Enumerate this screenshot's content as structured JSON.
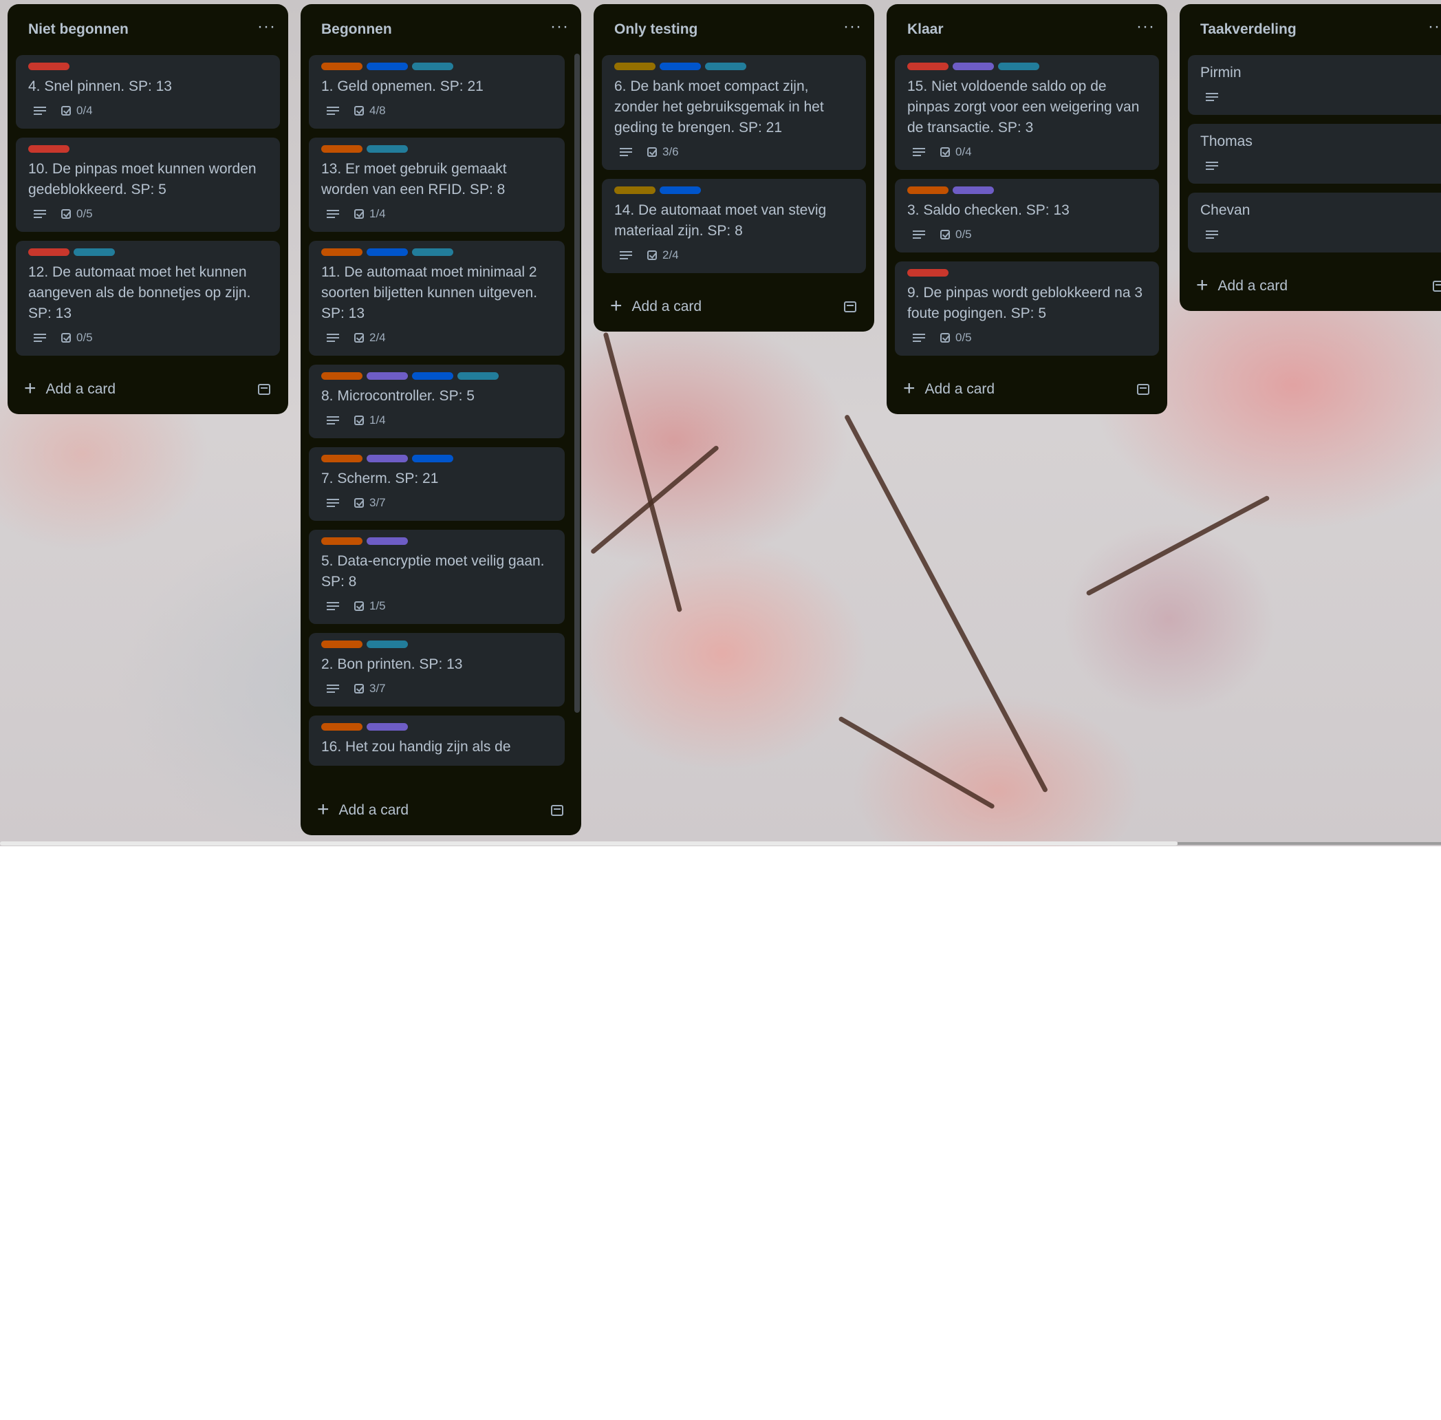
{
  "colors": {
    "red": "#c9372c",
    "orange": "#c25100",
    "blue": "#0055cc",
    "teal": "#227d9b",
    "purple": "#6e5dc6",
    "olive": "#946f00"
  },
  "add_card_label": "Add a card",
  "menu_glyph": "···",
  "lists": [
    {
      "title": "Niet begonnen",
      "cards": [
        {
          "labels": [
            "red"
          ],
          "title": "4. Snel pinnen. SP: 13",
          "checklist": "0/4"
        },
        {
          "labels": [
            "red"
          ],
          "title": "10. De pinpas moet kunnen worden gedeblokkeerd. SP: 5",
          "checklist": "0/5"
        },
        {
          "labels": [
            "red",
            "teal"
          ],
          "title": "12. De automaat moet het kunnen aangeven als de bonnetjes op zijn. SP: 13",
          "checklist": "0/5"
        }
      ]
    },
    {
      "title": "Begonnen",
      "cards": [
        {
          "labels": [
            "orange",
            "blue",
            "teal"
          ],
          "title": "1. Geld opnemen. SP: 21",
          "checklist": "4/8"
        },
        {
          "labels": [
            "orange",
            "teal"
          ],
          "title": "13. Er moet gebruik gemaakt worden van een RFID. SP: 8",
          "checklist": "1/4"
        },
        {
          "labels": [
            "orange",
            "blue",
            "teal"
          ],
          "title": "11. De automaat moet minimaal 2 soorten biljetten kunnen uitgeven. SP: 13",
          "checklist": "2/4"
        },
        {
          "labels": [
            "orange",
            "purple",
            "blue",
            "teal"
          ],
          "title": "8. Microcontroller. SP: 5",
          "checklist": "1/4"
        },
        {
          "labels": [
            "orange",
            "purple",
            "blue"
          ],
          "title": "7. Scherm. SP: 21",
          "checklist": "3/7"
        },
        {
          "labels": [
            "orange",
            "purple"
          ],
          "title": "5. Data-encryptie moet veilig gaan. SP: 8",
          "checklist": "1/5"
        },
        {
          "labels": [
            "orange",
            "teal"
          ],
          "title": "2. Bon printen. SP: 13",
          "checklist": "3/7"
        },
        {
          "labels": [
            "orange",
            "purple"
          ],
          "title": "16. Het zou handig zijn als de",
          "checklist": ""
        }
      ]
    },
    {
      "title": "Only testing",
      "cards": [
        {
          "labels": [
            "olive",
            "blue",
            "teal"
          ],
          "title": "6. De bank moet compact zijn, zonder het gebruiksgemak in het geding te brengen. SP: 21",
          "checklist": "3/6"
        },
        {
          "labels": [
            "olive",
            "blue"
          ],
          "title": "14. De automaat moet van stevig materiaal zijn. SP: 8",
          "checklist": "2/4"
        }
      ]
    },
    {
      "title": "Klaar",
      "cards": [
        {
          "labels": [
            "red",
            "purple",
            "teal"
          ],
          "title": "15. Niet voldoende saldo op de pinpas zorgt voor een weigering van de transactie. SP: 3",
          "checklist": "0/4"
        },
        {
          "labels": [
            "orange",
            "purple"
          ],
          "title": "3. Saldo checken. SP: 13",
          "checklist": "0/5"
        },
        {
          "labels": [
            "red"
          ],
          "title": "9. De pinpas wordt geblokkeerd na 3 foute pogingen. SP: 5",
          "checklist": "0/5"
        }
      ]
    },
    {
      "title": "Taakverdeling",
      "cards": [
        {
          "labels": [],
          "title": "Pirmin",
          "checklist": ""
        },
        {
          "labels": [],
          "title": "Thomas",
          "checklist": ""
        },
        {
          "labels": [],
          "title": "Chevan",
          "checklist": ""
        }
      ]
    }
  ]
}
